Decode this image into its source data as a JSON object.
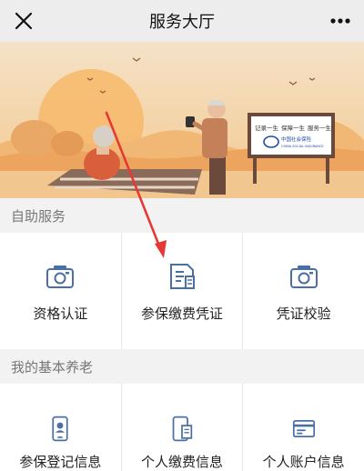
{
  "header": {
    "title": "服务大厅",
    "close_icon": "close-icon",
    "more_icon": "more-icon"
  },
  "banner": {
    "sign_text": [
      "记录一生",
      "保障一生",
      "服务一生"
    ],
    "logo_text": "中国社会保险",
    "logo_subtext": "CHINA SOCIAL INSURANCE"
  },
  "sections": [
    {
      "title": "自助服务",
      "items": [
        {
          "label": "资格认证",
          "icon": "camera-icon"
        },
        {
          "label": "参保缴费凭证",
          "icon": "receipt-icon"
        },
        {
          "label": "凭证校验",
          "icon": "camera-icon"
        }
      ]
    },
    {
      "title": "我的基本养老",
      "items": [
        {
          "label": "参保登记信息",
          "icon": "phone-id-icon"
        },
        {
          "label": "个人缴费信息",
          "icon": "phone-doc-icon"
        },
        {
          "label": "个人账户信息",
          "icon": "account-card-icon"
        }
      ]
    }
  ],
  "colors": {
    "accent_blue": "#4a6fa5",
    "arrow_red": "#e53935",
    "banner_sky": "#f6d9b3"
  }
}
